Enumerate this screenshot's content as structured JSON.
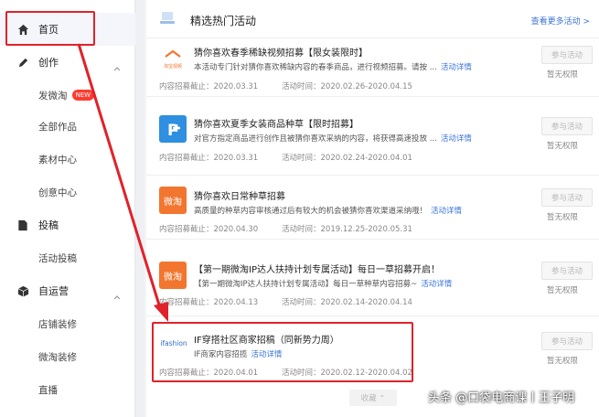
{
  "sidebar": {
    "home_label": "首页",
    "create": {
      "label": "创作",
      "items": [
        {
          "label": "发微淘",
          "badge": "NEW"
        },
        {
          "label": "全部作品"
        },
        {
          "label": "素材中心"
        },
        {
          "label": "创意中心"
        }
      ]
    },
    "submit": {
      "label": "投稿",
      "items": [
        {
          "label": "活动投稿"
        }
      ]
    },
    "self_ops": {
      "label": "自运营",
      "items": [
        {
          "label": "店铺装修"
        },
        {
          "label": "微淘装修"
        },
        {
          "label": "直播"
        }
      ]
    }
  },
  "header": {
    "title": "精选热门活动",
    "more_link": "查看更多活动 >"
  },
  "common": {
    "join_label": "参与活动",
    "no_perm": "暂无权限",
    "detail_link": "活动详情",
    "collapse_label": "收藏 ⌃"
  },
  "cards": [
    {
      "logo_text": "淘宝视频",
      "logo_color": "#ffffff",
      "title": "猜你喜欢春季稀缺视频招募【限女装限时】",
      "desc": "本活动专门针对猜你喜欢稀缺内容的春季商品，进行视频招募。请按 ...",
      "deadline": "内容招募截止：2020.03.31",
      "period": "活动时间：2020.02.26-2020.04.15"
    },
    {
      "logo_text": "P",
      "logo_color": "#2f8fe0",
      "title": "猜你喜欢夏季女装商品种草【限时招募】",
      "desc": "对官方指定商品进行创作且被猜你喜欢采纳的内容，将获得高速投放 ...",
      "deadline": "内容招募截止：2020.03.31",
      "period": "活动时间：2020.02.24-2020.04.01"
    },
    {
      "logo_text": "微淘",
      "logo_color": "#f2762f",
      "title": "猜你喜欢日常种草招募",
      "desc": "高质量的种草内容审核通过后有较大的机会被猜你喜欢渠道采纳哦！",
      "deadline": "内容招募截止：2020.04.30",
      "period": "活动时间：2019.12.25-2020.05.31"
    },
    {
      "logo_text": "微淘",
      "logo_color": "#f2762f",
      "title": "【第一期微淘IP达人扶持计划专属活动】每日一草招募开启！",
      "desc": "【第一期微淘IP达人扶持计划专属活动】每日一草种草内容招募~",
      "deadline": "内容招募截止：2020.04.13",
      "period": "活动时间：2020.02.14-2020.04.14"
    },
    {
      "logo_text": "ifashion",
      "logo_color": "#ffffff",
      "title": "IF穿搭社区商家招稿（同新势力周）",
      "desc": "IF商家内容招揽",
      "deadline": "内容招募截止：2020.04.01",
      "period": "活动时间：2020.02.12-2020.04.02"
    }
  ],
  "watermark": "头条 @口袋电商课丨王子明",
  "colors": {
    "accent": "#3a73d9",
    "highlight": "#e0222a",
    "orange": "#f2762f"
  }
}
